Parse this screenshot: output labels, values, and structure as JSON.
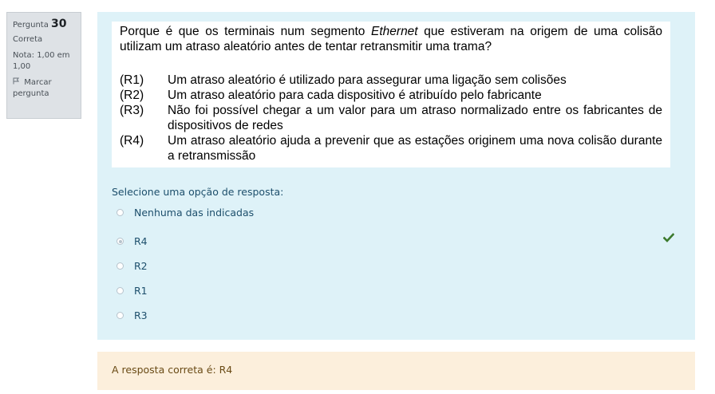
{
  "info": {
    "question_label": "Pergunta",
    "question_number": "30",
    "state": "Correta",
    "grade": "Nota: 1,00 em 1,00",
    "flag_label": "Marcar pergunta",
    "flag_icon": "flag-icon"
  },
  "question": {
    "text_before": "Porque é que os terminais num segmento ",
    "text_italic": "Ethernet",
    "text_after": " que estiveram na origem de uma colisão utilizam um atraso aleatório antes de tentar retransmitir uma trama?",
    "options": [
      {
        "code": "(R1)",
        "text": "Um atraso aleatório é utilizado para assegurar uma ligação sem colisões"
      },
      {
        "code": "(R2)",
        "text": "Um atraso aleatório para cada dispositivo é atribuído pelo fabricante"
      },
      {
        "code": "(R3)",
        "text": "Não foi possível chegar a um valor para um atraso normalizado entre os fabricantes de dispositivos de redes"
      },
      {
        "code": "(R4)",
        "text": "Um atraso aleatório ajuda a prevenir que as estações originem uma nova colisão durante a retransmissão"
      }
    ]
  },
  "prompt": "Selecione uma opção de resposta:",
  "answers": [
    {
      "label": "Nenhuma das indicadas",
      "checked": false
    },
    {
      "label": "R4",
      "checked": true
    },
    {
      "label": "R2",
      "checked": false
    },
    {
      "label": "R1",
      "checked": false
    },
    {
      "label": "R3",
      "checked": false
    }
  ],
  "correct_icon": "checkmark-icon",
  "correct_icon_color": "#3c7a2d",
  "right_answer": "A resposta correta é: R4"
}
